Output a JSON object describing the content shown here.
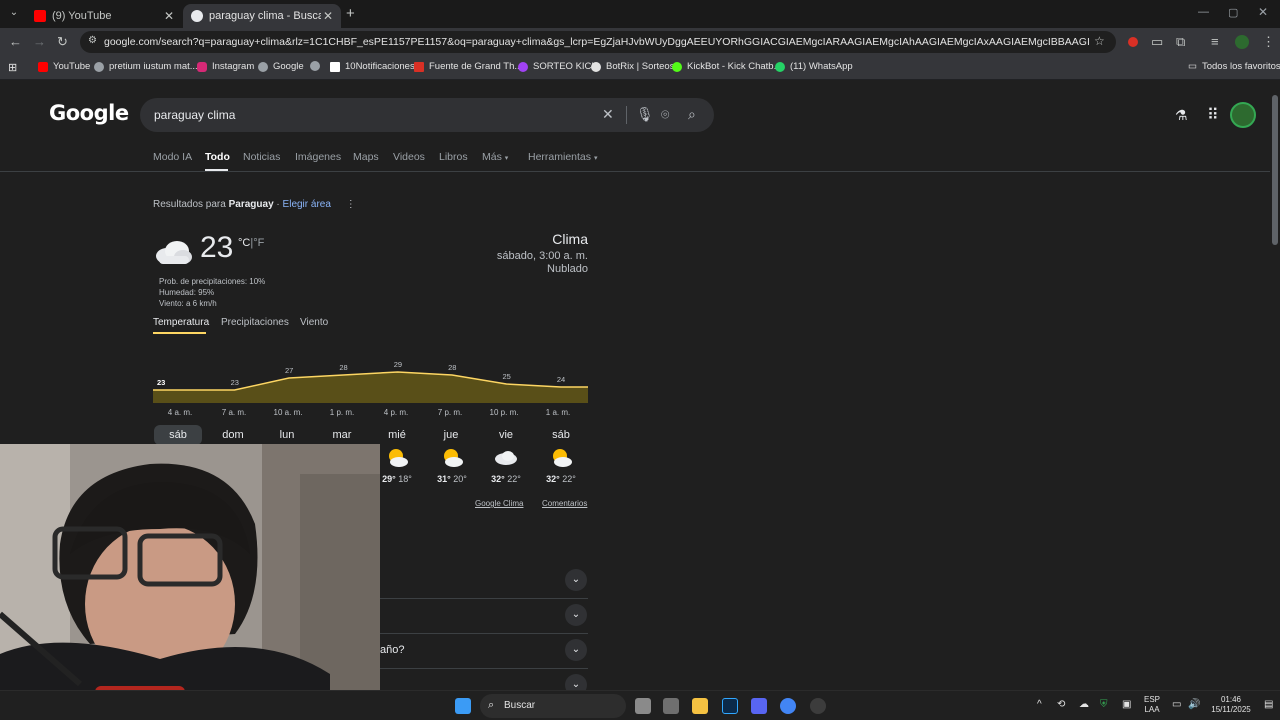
{
  "tabs": [
    {
      "title": "(9) YouTube",
      "active": false
    },
    {
      "title": "paraguay clima - Buscar con Go",
      "active": true
    }
  ],
  "toolbar": {
    "url": "google.com/search?q=paraguay+clima&rlz=1C1CHBF_esPE1157PE1157&oq=paraguay+clima&gs_lcrp=EgZjaHJvbWUyDggAEEUYORhGGIACGIAEMgcIARAAGIAEMgcIAhAAGIAEMgcIAxAAGIAEMgcIBBAAGIAEMggIBRAAGBYYHjIICAYQABg..."
  },
  "bookmarks": [
    {
      "label": "YouTube",
      "color": "#ff0000"
    },
    {
      "label": "pretium iustum mat...",
      "color": "#9aa0a6"
    },
    {
      "label": "Instagram",
      "color": "#d62976"
    },
    {
      "label": "Google",
      "color": "#9aa0a6"
    },
    {
      "label": "",
      "color": "#9aa0a6"
    },
    {
      "label": "10Notificaciones",
      "color": "#ffffff"
    },
    {
      "label": "Fuente de Grand Th...",
      "color": "#d93025"
    },
    {
      "label": "SORTEO KICK",
      "color": "#a142f4"
    },
    {
      "label": "BotRix | Sorteos",
      "color": "#e3e3e3"
    },
    {
      "label": "KickBot - Kick Chatb...",
      "color": "#53fc18"
    },
    {
      "label": "(11) WhatsApp",
      "color": "#25d366"
    }
  ],
  "bookmarks_all": "Todos los favoritos",
  "search": {
    "logo": "Google",
    "query": "paraguay clima",
    "tabs": [
      "Modo IA",
      "Todo",
      "Noticias",
      "Imágenes",
      "Maps",
      "Videos",
      "Libros",
      "Más",
      "Herramientas"
    ],
    "active_tab": "Todo"
  },
  "results_for": {
    "prefix": "Resultados para",
    "place": "Paraguay",
    "sep": "·",
    "link": "Elegir área"
  },
  "weather": {
    "temp": "23",
    "unit_c": "°C",
    "unit_sep": "|",
    "unit_f": "°F",
    "precip": "Prob. de precipitaciones: 10%",
    "humidity": "Humedad: 95%",
    "wind": "Viento: a 6 km/h",
    "title": "Clima",
    "time": "sábado, 3:00 a. m.",
    "condition": "Nublado",
    "tabs": [
      "Temperatura",
      "Precipitaciones",
      "Viento"
    ],
    "hours": [
      "4 a. m.",
      "7 a. m.",
      "10 a. m.",
      "1 p. m.",
      "4 p. m.",
      "7 p. m.",
      "10 p. m.",
      "1 a. m."
    ],
    "days": [
      {
        "name": "sáb",
        "icon": "cloud-icon",
        "hi": "",
        "lo": ""
      },
      {
        "name": "dom",
        "icon": "",
        "hi": "",
        "lo": ""
      },
      {
        "name": "lun",
        "icon": "",
        "hi": "",
        "lo": ""
      },
      {
        "name": "mar",
        "icon": "",
        "hi": "",
        "lo": ""
      },
      {
        "name": "mié",
        "icon": "partly-cloudy-icon",
        "hi": "29°",
        "lo": "18°"
      },
      {
        "name": "jue",
        "icon": "partly-cloudy-icon",
        "hi": "31°",
        "lo": "20°"
      },
      {
        "name": "vie",
        "icon": "cloud-icon",
        "hi": "32°",
        "lo": "22°"
      },
      {
        "name": "sáb",
        "icon": "partly-cloudy-icon",
        "hi": "32°",
        "lo": "22°"
      }
    ],
    "footer": [
      "Google Clima",
      "Comentarios"
    ]
  },
  "faq_partial": "año?",
  "chart_data": {
    "type": "area",
    "categories": [
      "4 a. m.",
      "7 a. m.",
      "10 a. m.",
      "1 p. m.",
      "4 p. m.",
      "7 p. m.",
      "10 p. m.",
      "1 a. m."
    ],
    "values": [
      23,
      23,
      27,
      28,
      29,
      28,
      25,
      24
    ],
    "labels": [
      "23",
      "23",
      "27",
      "28",
      "29",
      "28",
      "25",
      "24"
    ],
    "ylim": [
      0,
      30
    ],
    "title": "",
    "xlabel": "",
    "ylabel": "",
    "color": "#fdd663"
  },
  "taskbar": {
    "search": "Buscar",
    "lang1": "ESP",
    "lang2": "LAA",
    "time": "01:46",
    "date": "15/11/2025"
  }
}
